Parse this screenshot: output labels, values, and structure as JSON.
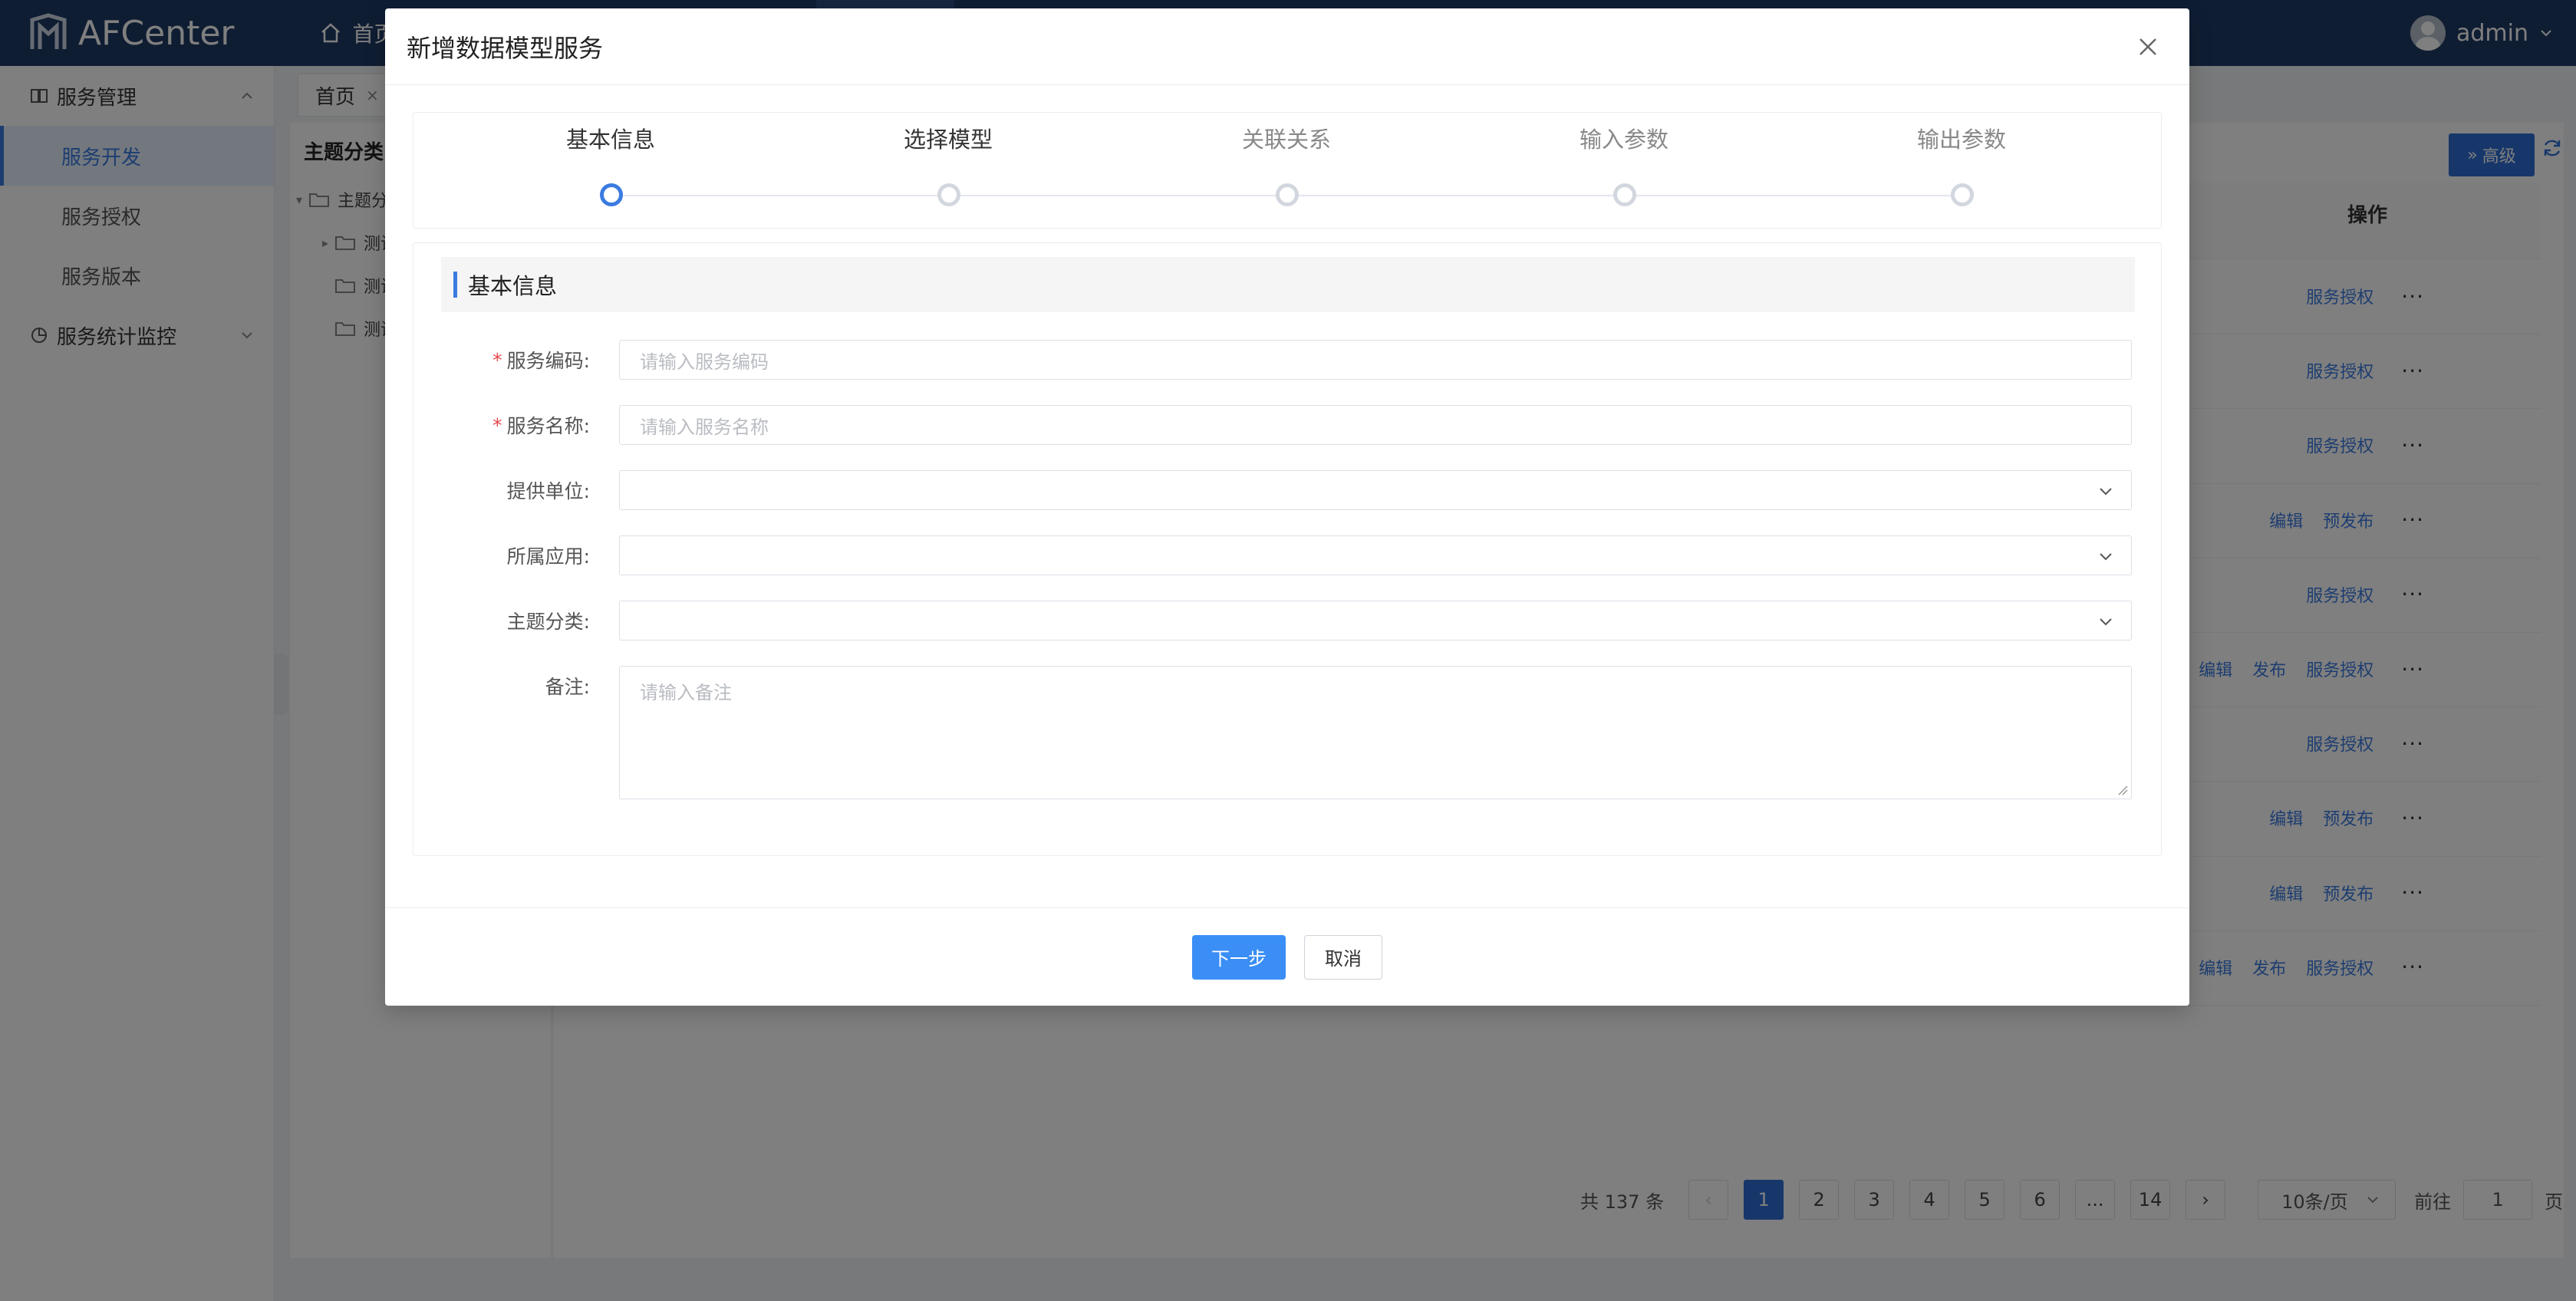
{
  "app": {
    "logo_text": "AFCenter",
    "home_nav": "首页",
    "user_name": "admin"
  },
  "sidebar": {
    "groups": [
      {
        "label": "服务管理",
        "icon": "book-icon",
        "expanded": true,
        "items": [
          {
            "label": "服务开发",
            "active": true
          },
          {
            "label": "服务授权",
            "active": false
          },
          {
            "label": "服务版本",
            "active": false
          }
        ]
      },
      {
        "label": "服务统计监控",
        "icon": "chart-pie-icon",
        "expanded": false,
        "items": []
      }
    ]
  },
  "tabs": {
    "home_label": "首页",
    "close_glyph": "×"
  },
  "tree": {
    "title": "主题分类",
    "root": "主题分",
    "children": [
      "测试",
      "测试",
      "测试"
    ]
  },
  "table": {
    "advanced_button": "高级",
    "operation_header": "操作",
    "rows": [
      {
        "actions": [
          "服务授权"
        ]
      },
      {
        "actions": [
          "服务授权"
        ]
      },
      {
        "actions": [
          "服务授权"
        ]
      },
      {
        "actions": [
          "编辑",
          "预发布"
        ]
      },
      {
        "actions": [
          "服务授权"
        ]
      },
      {
        "actions": [
          "编辑",
          "发布",
          "服务授权"
        ]
      },
      {
        "actions": [
          "服务授权"
        ]
      },
      {
        "actions": [
          "编辑",
          "预发布"
        ]
      },
      {
        "actions": [
          "编辑",
          "预发布"
        ]
      },
      {
        "actions": [
          "编辑",
          "发布",
          "服务授权"
        ]
      }
    ],
    "more_glyph": "···"
  },
  "pagination": {
    "total_text": "共 137 条",
    "prev": "‹",
    "next": "›",
    "pages": [
      "1",
      "2",
      "3",
      "4",
      "5",
      "6",
      "...",
      "14"
    ],
    "current_page": "1",
    "page_size": "10条/页",
    "goto_label": "前往",
    "goto_value": "1",
    "page_unit": "页"
  },
  "modal": {
    "title": "新增数据模型服务",
    "steps": [
      {
        "label": "基本信息",
        "state": "active"
      },
      {
        "label": "选择模型",
        "state": "next"
      },
      {
        "label": "关联关系",
        "state": "pending"
      },
      {
        "label": "输入参数",
        "state": "pending"
      },
      {
        "label": "输出参数",
        "state": "pending"
      }
    ],
    "section_title": "基本信息",
    "fields": {
      "service_code": {
        "label": "服务编码:",
        "required": true,
        "placeholder": "请输入服务编码",
        "value": ""
      },
      "service_name": {
        "label": "服务名称:",
        "required": true,
        "placeholder": "请输入服务名称",
        "value": ""
      },
      "provider_unit": {
        "label": "提供单位:",
        "required": false,
        "value": ""
      },
      "application": {
        "label": "所属应用:",
        "required": false,
        "value": ""
      },
      "topic_category": {
        "label": "主题分类:",
        "required": false,
        "value": ""
      },
      "remark": {
        "label": "备注:",
        "required": false,
        "placeholder": "请输入备注",
        "value": ""
      }
    },
    "required_mark": "*",
    "next_button": "下一步",
    "cancel_button": "取消"
  },
  "colors": {
    "topbar": "#1f3a66",
    "primary": "#3a8ef6",
    "link": "#3a7be0",
    "required": "#e5484d"
  }
}
